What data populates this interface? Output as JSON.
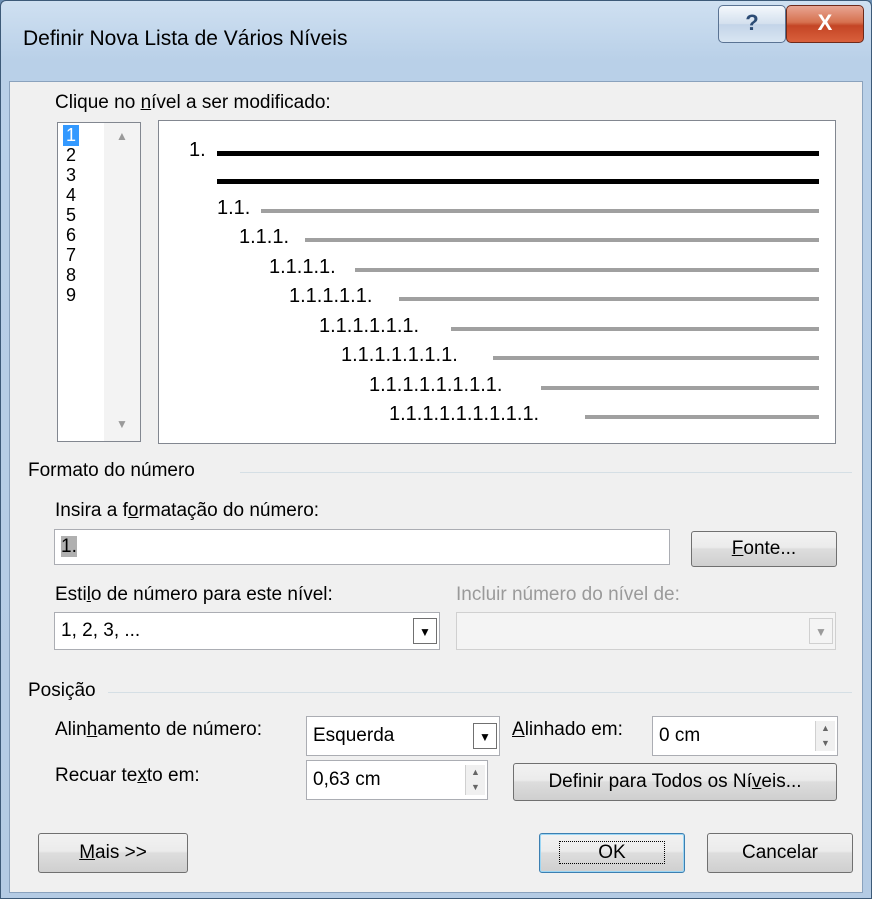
{
  "window": {
    "title": "Definir Nova Lista de Vários Níveis",
    "help_label": "?",
    "close_label": "X"
  },
  "level_prompt": {
    "before": "Clique no ",
    "accel": "n",
    "after": "ível a ser modificado:"
  },
  "levels": [
    "1",
    "2",
    "3",
    "4",
    "5",
    "6",
    "7",
    "8",
    "9"
  ],
  "selected_level": "1",
  "preview_lines": [
    {
      "text": "1."
    },
    {
      "text": ""
    },
    {
      "text": "1.1."
    },
    {
      "text": "1.1.1."
    },
    {
      "text": "1.1.1.1."
    },
    {
      "text": "1.1.1.1.1."
    },
    {
      "text": "1.1.1.1.1.1."
    },
    {
      "text": "1.1.1.1.1.1.1."
    },
    {
      "text": "1.1.1.1.1.1.1.1."
    },
    {
      "text": "1.1.1.1.1.1.1.1.1."
    }
  ],
  "number_format": {
    "section": "Formato do número",
    "input_label_before": "Insira a f",
    "input_label_accel": "o",
    "input_label_after": "rmatação do número:",
    "input_value": "1.",
    "font_button_accel": "F",
    "font_button_rest": "onte...",
    "style_label_before": "Esti",
    "style_label_accel": "l",
    "style_label_after": "o de número para este nível:",
    "style_value": "1, 2, 3, ...",
    "include_label": "Incluir número do nível de:",
    "include_value": ""
  },
  "position": {
    "section": "Posição",
    "align_label_before": "Alin",
    "align_label_accel": "h",
    "align_label_after": "amento de número:",
    "align_value": "Esquerda",
    "aligned_at_label_accel": "A",
    "aligned_at_label_rest": "linhado em:",
    "aligned_at_value": "0 cm",
    "indent_label_before": "Recuar te",
    "indent_label_accel": "x",
    "indent_label_after": "to em:",
    "indent_value": "0,63 cm",
    "set_all_before": "Definir para Todos os Ní",
    "set_all_accel": "v",
    "set_all_after": "eis..."
  },
  "buttons": {
    "more_accel": "M",
    "more_rest": "ais >>",
    "ok": "OK",
    "cancel": "Cancelar"
  }
}
